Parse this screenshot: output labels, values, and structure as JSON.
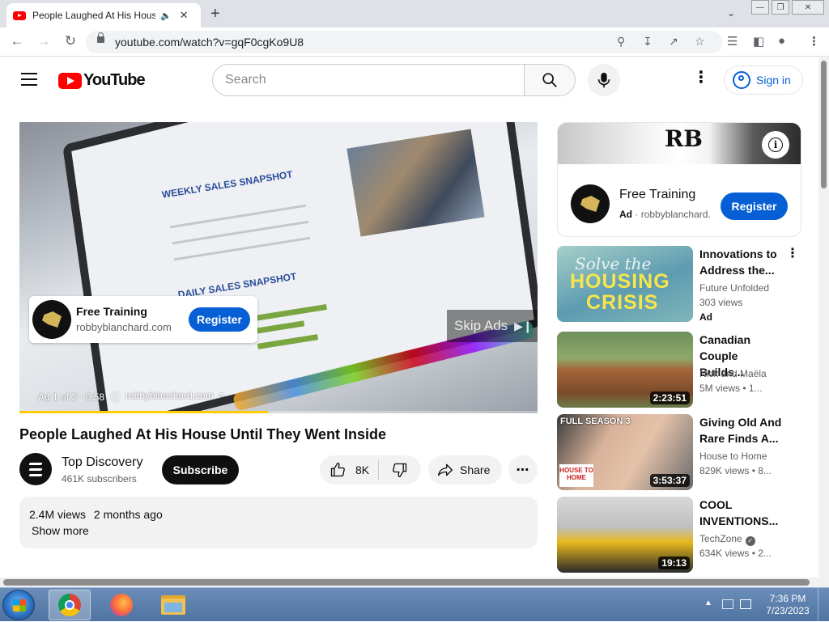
{
  "browser": {
    "tab_title": "People Laughed At His House Until They Went Inside - YouTube",
    "url": "youtube.com/watch?v=gqF0cgKo9U8",
    "new_tab_icon": "plus-icon",
    "colors": {
      "tabbar": "#dee1e6",
      "toolbar": "#ffffff"
    }
  },
  "masthead": {
    "logo_text": "YouTube",
    "search_placeholder": "Search",
    "signin_label": "Sign in",
    "colors": {
      "brand_red": "#ff0000",
      "link_blue": "#065fd4"
    }
  },
  "player": {
    "ad_card": {
      "title": "Free Training",
      "domain": "robbyblanchard.com",
      "button": "Register"
    },
    "skip_label": "Skip Ads",
    "ad_counter": "Ad 1 of 2 · 0:58",
    "ad_link": "robbyblanchard.com",
    "screen_text": {
      "weekly": "WEEKLY SALES SNAPSHOT",
      "daily": "DAILY SALES SNAPSHOT"
    },
    "progress": 0.48
  },
  "video": {
    "title": "People Laughed At His House Until They Went Inside",
    "channel": "Top Discovery",
    "subscribers": "461K subscribers",
    "subscribe_label": "Subscribe",
    "likes": "8K",
    "share_label": "Share",
    "views": "2.4M views",
    "age": "2 months ago",
    "show_more": "Show more"
  },
  "sidebar_ad": {
    "title": "Free Training",
    "ad_label": "Ad",
    "advertiser": "robbyblanchard.",
    "button": "Register",
    "banner_logo": "RB"
  },
  "recommended": [
    {
      "title": "Innovations to Address the...",
      "channel": "Future Unfolded",
      "views": "303 views",
      "badge": "Ad",
      "thumb_text": [
        "Solve the",
        "HOUSING",
        "CRISIS"
      ]
    },
    {
      "title": "Canadian Couple Builds...",
      "channel": "Nick and Maëla",
      "views": "5M views",
      "age": "1...",
      "duration": "2:23:51"
    },
    {
      "title": "Giving Old And Rare Finds A...",
      "channel": "House to Home",
      "views": "829K views",
      "age": "8...",
      "duration": "3:53:37",
      "thumb_text": [
        "FULL SEASON 3",
        "HOUSE TO HOME"
      ]
    },
    {
      "title": "COOL INVENTIONS...",
      "channel": "TechZone",
      "verified": true,
      "views": "634K views",
      "age": "2...",
      "duration": "19:13"
    }
  ],
  "taskbar": {
    "time": "7:36 PM",
    "date": "7/23/2023",
    "apps": [
      "chrome-icon",
      "firefox-icon",
      "file-explorer-icon"
    ]
  }
}
